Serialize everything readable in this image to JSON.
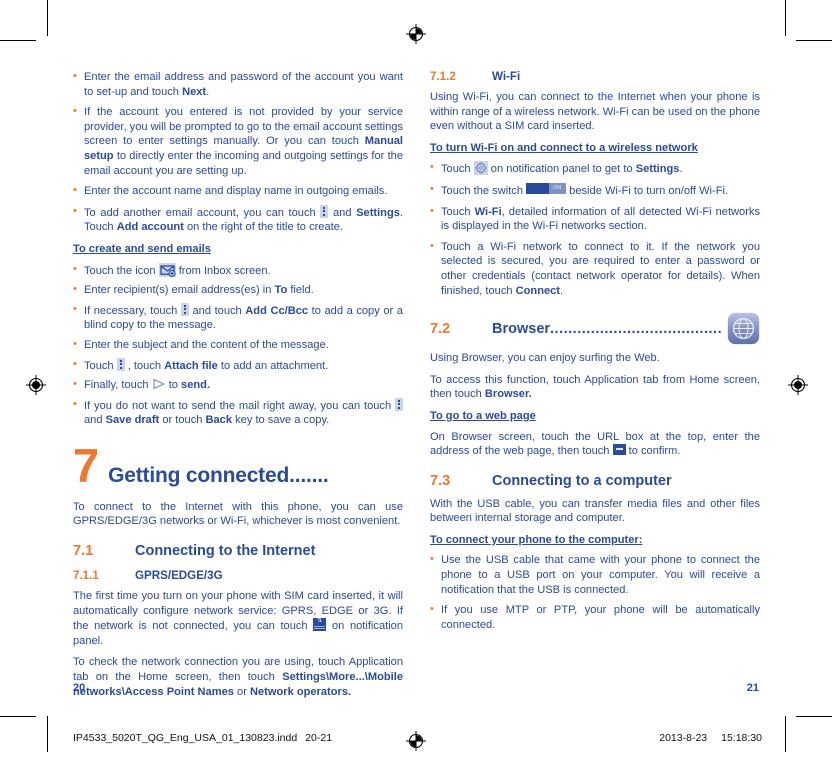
{
  "document": {
    "page_left_number": "20",
    "page_right_number": "21",
    "colors": {
      "body_blue": "#2a4a9c",
      "accent_orange": "#f0762c",
      "icon_fill": "#c9d3ea"
    }
  },
  "footer": {
    "filename": "IP4533_5020T_QG_Eng_USA_01_130823.indd",
    "pages": "20-21",
    "date": "2013-8-23",
    "time": "15:18:30"
  },
  "left_column": {
    "top_bullets": [
      {
        "parts": [
          {
            "t": "Enter the email address and password of the account you want to set-up and touch ",
            "b": false
          },
          {
            "t": "Next",
            "b": true
          },
          {
            "t": ".",
            "b": false
          }
        ]
      },
      {
        "parts": [
          {
            "t": "If the account you entered is not provided by your service provider, you will be prompted to go to the email account settings screen to enter settings manually. Or you can touch ",
            "b": false
          },
          {
            "t": "Manual setup",
            "b": true
          },
          {
            "t": " to directly enter the incoming and outgoing settings for the email account you are setting up.",
            "b": false
          }
        ]
      },
      {
        "parts": [
          {
            "t": "Enter the account name and display name in outgoing emails.",
            "b": false
          }
        ]
      },
      {
        "parts": [
          {
            "t": "To add another email account, you can touch ",
            "b": false
          },
          {
            "t": "[menu-icon]",
            "icon": "menu-icon"
          },
          {
            "t": " and ",
            "b": false
          },
          {
            "t": "Settings",
            "b": true
          },
          {
            "t": ". Touch ",
            "b": false
          },
          {
            "t": "Add account",
            "b": true
          },
          {
            "t": " on the right of the title to create.",
            "b": false
          }
        ]
      }
    ],
    "create_send_heading": "To create and send emails",
    "create_send_bullets": [
      {
        "parts": [
          {
            "t": "Touch the icon ",
            "b": false
          },
          {
            "t": "[compose-icon]",
            "icon": "compose-icon"
          },
          {
            "t": " from Inbox screen.",
            "b": false
          }
        ]
      },
      {
        "parts": [
          {
            "t": "Enter recipient(s) email address(es) in ",
            "b": false
          },
          {
            "t": "To",
            "b": true
          },
          {
            "t": " field.",
            "b": false
          }
        ]
      },
      {
        "parts": [
          {
            "t": "If necessary, touch ",
            "b": false
          },
          {
            "t": "[menu-icon]",
            "icon": "menu-icon"
          },
          {
            "t": " and touch ",
            "b": false
          },
          {
            "t": "Add Cc/Bcc",
            "b": true
          },
          {
            "t": " to add a copy or a blind copy to the message.",
            "b": false
          }
        ]
      },
      {
        "parts": [
          {
            "t": "Enter the subject and the content of the message.",
            "b": false
          }
        ]
      },
      {
        "parts": [
          {
            "t": "Touch ",
            "b": false
          },
          {
            "t": "[menu-icon]",
            "icon": "menu-icon"
          },
          {
            "t": " , touch ",
            "b": false
          },
          {
            "t": "Attach file",
            "b": true
          },
          {
            "t": " to add an attachment.",
            "b": false
          }
        ]
      },
      {
        "parts": [
          {
            "t": "Finally, touch ",
            "b": false
          },
          {
            "t": "[send-icon]",
            "icon": "send-icon"
          },
          {
            "t": " to ",
            "b": false
          },
          {
            "t": "send.",
            "b": true
          }
        ]
      },
      {
        "parts": [
          {
            "t": "If you do not want to send the mail right away, you can touch ",
            "b": false
          },
          {
            "t": "[menu-icon]",
            "icon": "menu-icon"
          },
          {
            "t": " and ",
            "b": false
          },
          {
            "t": "Save draft",
            "b": true
          },
          {
            "t": " or touch ",
            "b": false
          },
          {
            "t": "Back",
            "b": true
          },
          {
            "t": " key to save a copy.",
            "b": false
          }
        ]
      }
    ],
    "chapter": {
      "number": "7",
      "title": "Getting connected......."
    },
    "chapter_intro": "To connect to the Internet with this phone, you can use GPRS/EDGE/3G networks or Wi-Fi, whichever is most convenient.",
    "section_7_1": {
      "number": "7.1",
      "title": "Connecting to the Internet"
    },
    "section_7_1_1": {
      "number": "7.1.1",
      "title": "GPRS/EDGE/3G"
    },
    "gprs_para_1": {
      "parts": [
        {
          "t": "The first time you turn on your phone with SIM card inserted, it will automatically configure network service: GPRS, EDGE or 3G. If the network is not connected, you can touch ",
          "b": false
        },
        {
          "t": "[network-icon]",
          "icon": "network-icon"
        },
        {
          "t": " on notification panel.",
          "b": false
        }
      ]
    },
    "gprs_para_2": {
      "parts": [
        {
          "t": "To check the network connection you are using, touch Application tab on the Home screen, then touch ",
          "b": false
        },
        {
          "t": "Settings\\More...\\Mobile networks\\Access Point Names",
          "b": true
        },
        {
          "t": " or ",
          "b": false
        },
        {
          "t": "Network operators.",
          "b": true
        }
      ]
    }
  },
  "right_column": {
    "section_7_1_2": {
      "number": "7.1.2",
      "title": "Wi-Fi"
    },
    "wifi_intro": "Using Wi-Fi, you can connect to the Internet when your phone is within range of a wireless network. Wi-Fi can be used on the phone even without a SIM card inserted.",
    "wifi_heading": "To turn Wi-Fi on and connect to a wireless network",
    "wifi_bullets": [
      {
        "parts": [
          {
            "t": "Touch ",
            "b": false
          },
          {
            "t": "[gear-icon]",
            "icon": "gear-icon"
          },
          {
            "t": " on notification panel to get to ",
            "b": false
          },
          {
            "t": "Settings",
            "b": true
          },
          {
            "t": ".",
            "b": false
          }
        ]
      },
      {
        "parts": [
          {
            "t": "Touch the switch ",
            "b": false
          },
          {
            "t": "[switch-icon]",
            "icon": "switch-icon"
          },
          {
            "t": " beside Wi-Fi to turn on/off Wi-Fi.",
            "b": false
          }
        ]
      },
      {
        "parts": [
          {
            "t": "Touch ",
            "b": false
          },
          {
            "t": "Wi-Fi",
            "b": true
          },
          {
            "t": ", detailed information of all detected Wi-Fi networks is displayed in the Wi-Fi networks section.",
            "b": false
          }
        ]
      },
      {
        "parts": [
          {
            "t": "Touch a Wi-Fi network to connect to it. If the network you selected is secured, you are required to enter a password or other credentials (contact network operator for details). When finished, touch ",
            "b": false
          },
          {
            "t": "Connect",
            "b": true
          },
          {
            "t": ".",
            "b": false
          }
        ]
      }
    ],
    "section_7_2": {
      "number": "7.2",
      "title": "Browser",
      "dots": "......................................",
      "icon": "browser-globe-icon"
    },
    "browser_intro": "Using Browser, you can enjoy surfing the Web.",
    "browser_para": {
      "parts": [
        {
          "t": "To access this function, touch Application tab from Home screen, then touch ",
          "b": false
        },
        {
          "t": "Browser.",
          "b": true
        }
      ]
    },
    "web_page_heading": "To go to a web page",
    "web_page_para": {
      "parts": [
        {
          "t": "On Browser screen, touch the URL box at the top, enter the address of the web page, then touch ",
          "b": false
        },
        {
          "t": "[go-icon]",
          "icon": "go-icon"
        },
        {
          "t": " to confirm.",
          "b": false
        }
      ]
    },
    "section_7_3": {
      "number": "7.3",
      "title": "Connecting to a computer"
    },
    "usb_intro": "With the USB cable, you can transfer media files and other files between internal storage and computer.",
    "usb_heading": "To connect your phone to the computer:",
    "usb_bullets": [
      {
        "parts": [
          {
            "t": "Use the USB cable that came with your phone to connect the phone to a USB port on your computer. You will receive a notification that the USB is connected.",
            "b": false
          }
        ]
      },
      {
        "parts": [
          {
            "t": "If you use MTP or PTP, your phone will be automatically connected.",
            "b": false
          }
        ]
      }
    ]
  }
}
